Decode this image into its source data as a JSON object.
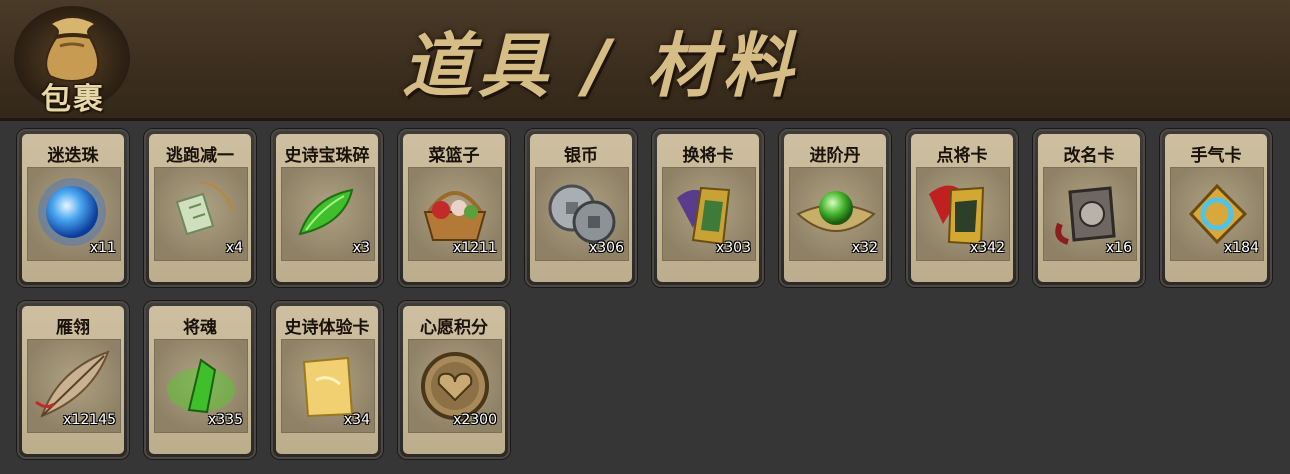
{
  "header": {
    "bag_label": "包裹",
    "title": "道具 / 材料"
  },
  "colors": {
    "header_bg": "#3c2e1e",
    "title_gold": "#d6bd86",
    "card_bg": "#c6b796",
    "page_bg": "#363636"
  },
  "items": [
    {
      "name": "迷迭珠",
      "qty": "x11",
      "icon": "blue-orb-icon"
    },
    {
      "name": "逃跑减一",
      "qty": "x4",
      "icon": "jade-tag-icon"
    },
    {
      "name": "史诗宝珠碎",
      "qty": "x3",
      "icon": "green-shard-icon"
    },
    {
      "name": "菜篮子",
      "qty": "x1211",
      "icon": "basket-icon"
    },
    {
      "name": "银币",
      "qty": "x306",
      "icon": "silver-coins-icon"
    },
    {
      "name": "换将卡",
      "qty": "x303",
      "icon": "swap-card-icon"
    },
    {
      "name": "进阶丹",
      "qty": "x32",
      "icon": "green-pill-icon"
    },
    {
      "name": "点将卡",
      "qty": "x342",
      "icon": "summon-card-icon"
    },
    {
      "name": "改名卡",
      "qty": "x16",
      "icon": "rename-card-icon"
    },
    {
      "name": "手气卡",
      "qty": "x184",
      "icon": "luck-card-icon"
    },
    {
      "name": "雁翎",
      "qty": "x12145",
      "icon": "feather-icon"
    },
    {
      "name": "将魂",
      "qty": "x335",
      "icon": "soul-crystal-icon"
    },
    {
      "name": "史诗体验卡",
      "qty": "x34",
      "icon": "gold-card-icon"
    },
    {
      "name": "心愿积分",
      "qty": "x2300",
      "icon": "heart-coin-icon"
    }
  ]
}
